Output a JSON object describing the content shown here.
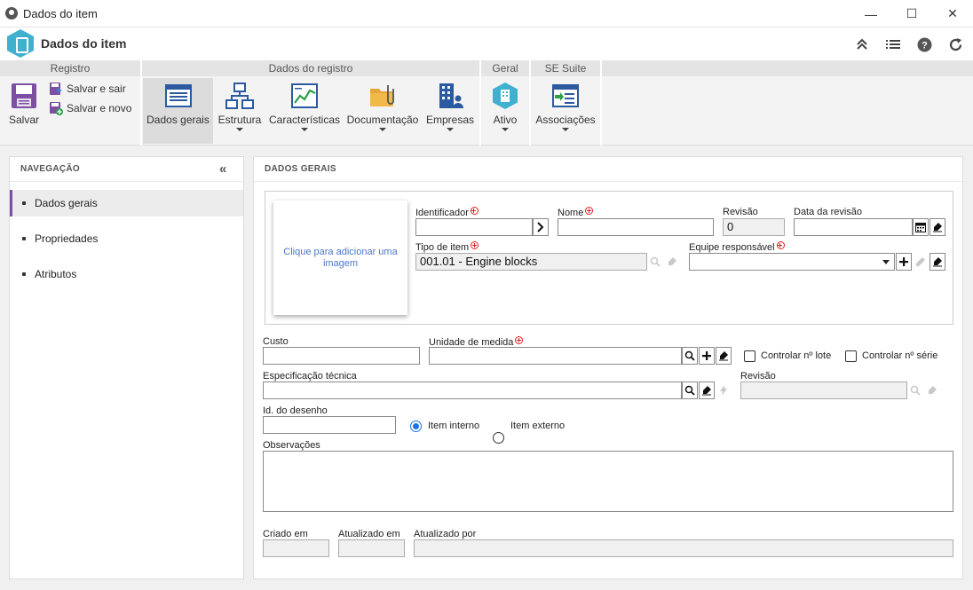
{
  "window": {
    "title": "Dados do item",
    "minimize_glyph": "—",
    "maximize_glyph": "☐",
    "close_glyph": "✕"
  },
  "app_header": {
    "title": "Dados do item",
    "icons": [
      "collapse-up-icon",
      "list-icon",
      "help-icon",
      "refresh-icon"
    ]
  },
  "ribbon": {
    "groups": {
      "registro": "Registro",
      "dados_registro": "Dados do registro",
      "geral": "Geral",
      "se_suite": "SE Suite"
    },
    "buttons": {
      "salvar": "Salvar",
      "salvar_sair": "Salvar e sair",
      "salvar_novo": "Salvar e novo",
      "dados_gerais": "Dados gerais",
      "estrutura": "Estrutura",
      "caracteristicas": "Características",
      "documentacao": "Documentação",
      "empresas": "Empresas",
      "ativo": "Ativo",
      "associacoes": "Associações"
    }
  },
  "navigation": {
    "title": "NAVEGAÇÃO",
    "items": [
      {
        "label": "Dados gerais",
        "active": true
      },
      {
        "label": "Propriedades",
        "active": false
      },
      {
        "label": "Atributos",
        "active": false
      }
    ]
  },
  "general": {
    "title": "DADOS GERAIS",
    "image_placeholder": "Clique para adicionar uma imagem",
    "labels": {
      "identificador": "Identificador",
      "nome": "Nome",
      "revisao": "Revisão",
      "data_revisao": "Data da revisão",
      "tipo_item": "Tipo de item",
      "equipe": "Equipe responsável",
      "custo": "Custo",
      "unidade": "Unidade de medida",
      "controlar_lote": "Controlar nº lote",
      "controlar_serie": "Controlar nº série",
      "especificacao": "Especificação técnica",
      "revisao_esp": "Revisão",
      "id_desenho": "Id. do desenho",
      "item_interno": "Item interno",
      "item_externo": "Item externo",
      "observacoes": "Observações",
      "criado_em": "Criado em",
      "atualizado_em": "Atualizado em",
      "atualizado_por": "Atualizado por"
    },
    "values": {
      "identificador": "",
      "nome": "",
      "revisao": "0",
      "data_revisao": "",
      "tipo_item": "001.01 - Engine blocks",
      "equipe": "",
      "custo": "",
      "unidade": "",
      "especificacao": "",
      "revisao_esp": "",
      "id_desenho": "",
      "observacoes": "",
      "criado_em": "",
      "atualizado_em": "",
      "atualizado_por": ""
    },
    "item_origin_selected": "Item interno",
    "controlar_lote_checked": false,
    "controlar_serie_checked": false
  },
  "colors": {
    "accent_purple": "#7d4fa3",
    "link_blue": "#4a78c8",
    "radio_blue": "#1a73e8",
    "logo_teal": "#3fb1cf",
    "required_red": "#d22222"
  }
}
